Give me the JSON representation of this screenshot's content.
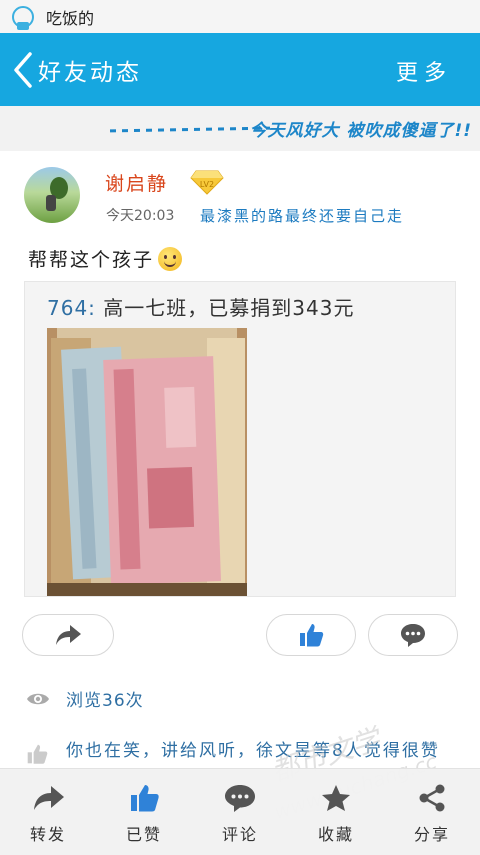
{
  "status_bar": {
    "app_name": "吃饭的"
  },
  "nav": {
    "title": "好友动态",
    "more_label": "更多"
  },
  "banner": {
    "text": "今天风好大 被吹成傻逼了!!"
  },
  "post": {
    "author": "谢启静",
    "vip_level": "LV2",
    "time": "今天20:03",
    "signature": "最漆黑的路最终还要自己走",
    "text": "帮帮这个孩子",
    "shared": {
      "title_number": "764:",
      "title_rest": "高一七班，已募捐到343元"
    }
  },
  "stats": {
    "views": "浏览36次",
    "likes_text": "你也在笑，讲给风听，徐文昱等8人觉得很赞"
  },
  "bottom_tabs": [
    {
      "label": "转发",
      "icon": "forward-icon"
    },
    {
      "label": "已赞",
      "icon": "thumbs-up-icon"
    },
    {
      "label": "评论",
      "icon": "comment-icon"
    },
    {
      "label": "收藏",
      "icon": "star-icon"
    },
    {
      "label": "分享",
      "icon": "share-icon"
    }
  ],
  "watermark": {
    "main": "都市文学",
    "url": "www.duchang.cc"
  },
  "colors": {
    "nav_bg": "#16a7e0",
    "accent_blue": "#2f6fa3",
    "name_red": "#d9461c"
  }
}
